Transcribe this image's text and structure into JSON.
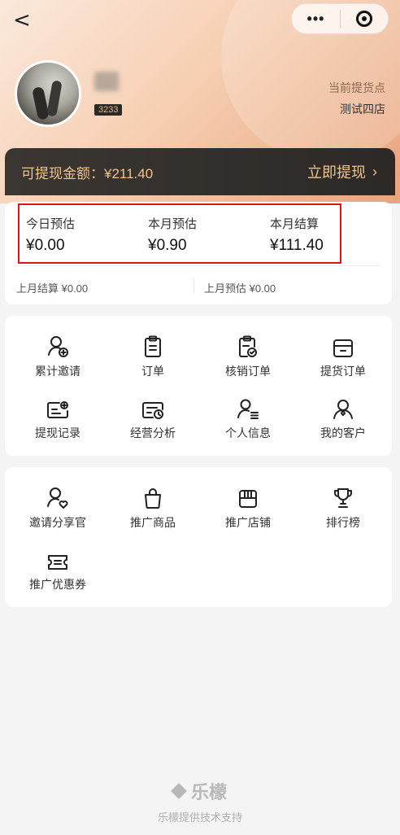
{
  "nav": {
    "back_glyph": "<",
    "menu_glyph": "•••"
  },
  "profile": {
    "user_id": "3233",
    "store_label": "当前提货点",
    "store_name": "测试四店"
  },
  "withdraw": {
    "amount_text": "可提现金额：¥211.40",
    "action_label": "立即提现",
    "action_chevron": "›"
  },
  "stats": [
    {
      "label": "今日预估",
      "value": "¥0.00"
    },
    {
      "label": "本月预估",
      "value": "¥0.90"
    },
    {
      "label": "本月结算",
      "value": "¥111.40"
    }
  ],
  "last_month": {
    "settle": "上月结算 ¥0.00",
    "estimate": "上月预估 ¥0.00"
  },
  "menu1": [
    {
      "label": "累计邀请",
      "icon": "user-add-icon"
    },
    {
      "label": "订单",
      "icon": "clipboard-icon"
    },
    {
      "label": "核销订单",
      "icon": "clipboard-check-icon"
    },
    {
      "label": "提货订单",
      "icon": "box-icon"
    },
    {
      "label": "提现记录",
      "icon": "withdraw-record-icon"
    },
    {
      "label": "经营分析",
      "icon": "analysis-icon"
    },
    {
      "label": "个人信息",
      "icon": "user-info-icon"
    },
    {
      "label": "我的客户",
      "icon": "customer-icon"
    }
  ],
  "menu2": [
    {
      "label": "邀请分享官",
      "icon": "user-heart-icon"
    },
    {
      "label": "推广商品",
      "icon": "shopping-bag-icon"
    },
    {
      "label": "推广店铺",
      "icon": "store-icon"
    },
    {
      "label": "排行榜",
      "icon": "trophy-icon"
    },
    {
      "label": "推广优惠券",
      "icon": "coupon-icon"
    }
  ],
  "footer": {
    "logo_text": "乐檬",
    "support_text": "乐檬提供技术支持"
  },
  "colors": {
    "accent_gold": "#f1c38e",
    "highlight_red": "#e01414",
    "dark_bar": "#2c2926"
  }
}
